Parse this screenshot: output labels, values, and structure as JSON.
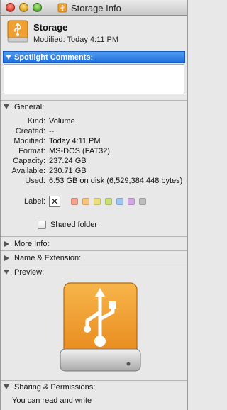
{
  "window": {
    "title": "Storage Info",
    "name": "Storage",
    "modified_line": "Modified: Today 4:11 PM"
  },
  "spotlight": {
    "label": "Spotlight Comments:",
    "comment": ""
  },
  "general": {
    "label": "General:",
    "rows": [
      {
        "key": "Kind:",
        "value": "Volume"
      },
      {
        "key": "Created:",
        "value": "--"
      },
      {
        "key": "Modified:",
        "value": "Today 4:11 PM"
      },
      {
        "key": "Format:",
        "value": "MS-DOS (FAT32)"
      },
      {
        "key": "Capacity:",
        "value": "237.24 GB"
      },
      {
        "key": "Available:",
        "value": "230.71 GB"
      }
    ],
    "used_key": "Used:",
    "used_value": "6.53 GB on disk (6,529,384,448 bytes)",
    "label_key": "Label:",
    "label_none_glyph": "✕",
    "label_colors": [
      "#f4a38e",
      "#f6c57a",
      "#ecdf7a",
      "#c9e07a",
      "#9cc6f0",
      "#d3a6e6",
      "#bdbdbd"
    ],
    "shared_folder_label": "Shared folder",
    "shared_folder_checked": false
  },
  "more_info": {
    "label": "More Info:"
  },
  "name_ext": {
    "label": "Name & Extension:"
  },
  "preview": {
    "label": "Preview:",
    "icon": "usb-drive-icon",
    "accent": "#f0a030"
  },
  "sharing": {
    "label": "Sharing & Permissions:",
    "text": "You can read and write"
  }
}
